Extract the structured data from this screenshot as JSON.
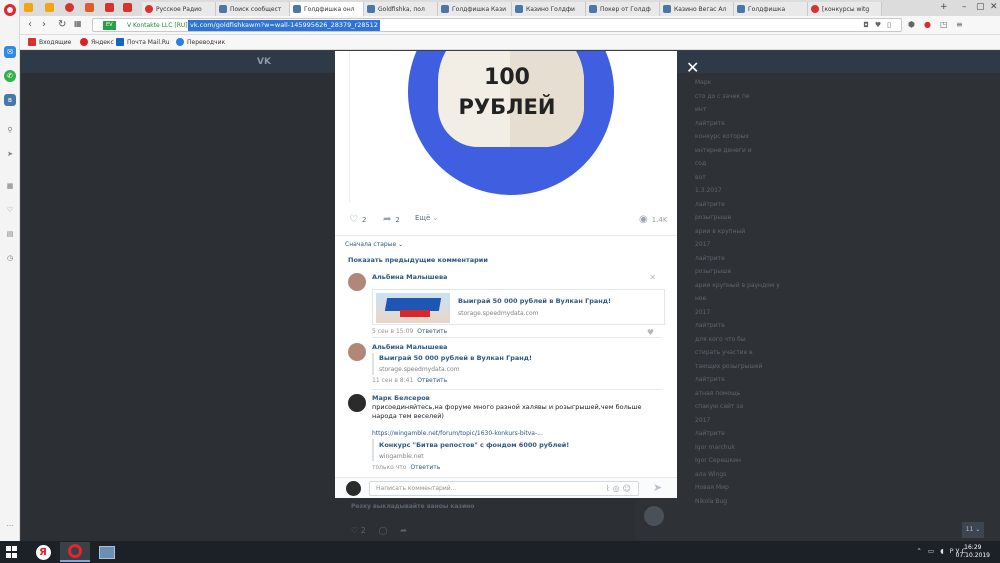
{
  "browser": {
    "tabs": [
      {
        "title": "Русское Радио",
        "fav": "red"
      },
      {
        "title": "Поиск сообщест",
        "fav": "vk"
      },
      {
        "title": "Голдфишка онл",
        "fav": "vk",
        "active": true
      },
      {
        "title": "Goldfishka, пол",
        "fav": "vk"
      },
      {
        "title": "Голдфишка Кази",
        "fav": "vk"
      },
      {
        "title": "Казино Голдфи",
        "fav": "vk"
      },
      {
        "title": "Покер от Голдф",
        "fav": "vk"
      },
      {
        "title": "Казино Вегас Ал",
        "fav": "vk"
      },
      {
        "title": "Голдфишка",
        "fav": "vk"
      },
      {
        "title": "[конкурсы witg",
        "fav": "red"
      }
    ],
    "security_badge": "EV",
    "certificate": "V Kontakte LLC [RU]",
    "url": "vk.com/goldfishkawm?w=wall-145995626_28379_r28512",
    "bookmarks": [
      "Входящие",
      "Яндекс",
      "Почта Mail.Ru",
      "Переводчик"
    ]
  },
  "post": {
    "image_line1": "100",
    "image_line2": "РУБЛЕЙ",
    "likes": "2",
    "shares": "2",
    "more_label": "Ещё",
    "views": "1.4K"
  },
  "comments_section": {
    "sort_label": "Сначала старые",
    "show_previous": "Показать предыдущие комментарии",
    "items": [
      {
        "author": "Альбина Малышева",
        "attachment_title": "Выиграй 50 000 рублей в Вулкан Гранд!",
        "attachment_url": "storage.speedmydata.com",
        "time": "5 сен в 15:09",
        "reply": "Ответить"
      },
      {
        "author": "Альбина Малышева",
        "attachment_title": "Выиграй 50 000 рублей в Вулкан Гранд!",
        "attachment_url": "storage.speedmydata.com",
        "time": "11 сен в 8:41",
        "reply": "Ответить"
      },
      {
        "author": "Марк Белсеров",
        "text": "присоединяйтесь,на форуме много разной халявы и розыгрышей,чем больше народа тем веселей)",
        "link": "https://wingamble.net/forum/topic/1630-konkurs-bitva-...",
        "attachment_title": "Конкурс \"Битва репостов\" с фондом 6000 рублей!",
        "attachment_url": "wingamble.net",
        "time": "только что",
        "reply": "Ответить"
      }
    ],
    "compose_placeholder": "Написать комментарий..."
  },
  "background": {
    "right_column": [
      "Марк",
      "сто до с зачек пе",
      "инт",
      "лайтрите",
      "конкурс которых",
      "интерне денеги и",
      "сод",
      "вот",
      "1.3.2017",
      "лайтрите",
      "розыгрыше",
      "арии в крупный",
      "2017",
      "лайтрите",
      "розыгрыше",
      "арии крупный в раундом у",
      "ное",
      "2017",
      "лайтрите",
      "для кого что бы",
      "стирать участие в",
      "тающих розыгрышей",
      "лайтрите",
      "атная помощь",
      "спакую сайт за",
      "2017",
      "лайтрите",
      "Igor marchuk",
      "Igor Серешкин",
      "ала Wings",
      "Новая Мир",
      "Nikola Bug"
    ],
    "left_text": "Резку выкладывайте ваноы казино",
    "scroll_counter": "11"
  },
  "taskbar": {
    "lang": "РУС",
    "time": "16:29",
    "date": "07.10.2019"
  }
}
